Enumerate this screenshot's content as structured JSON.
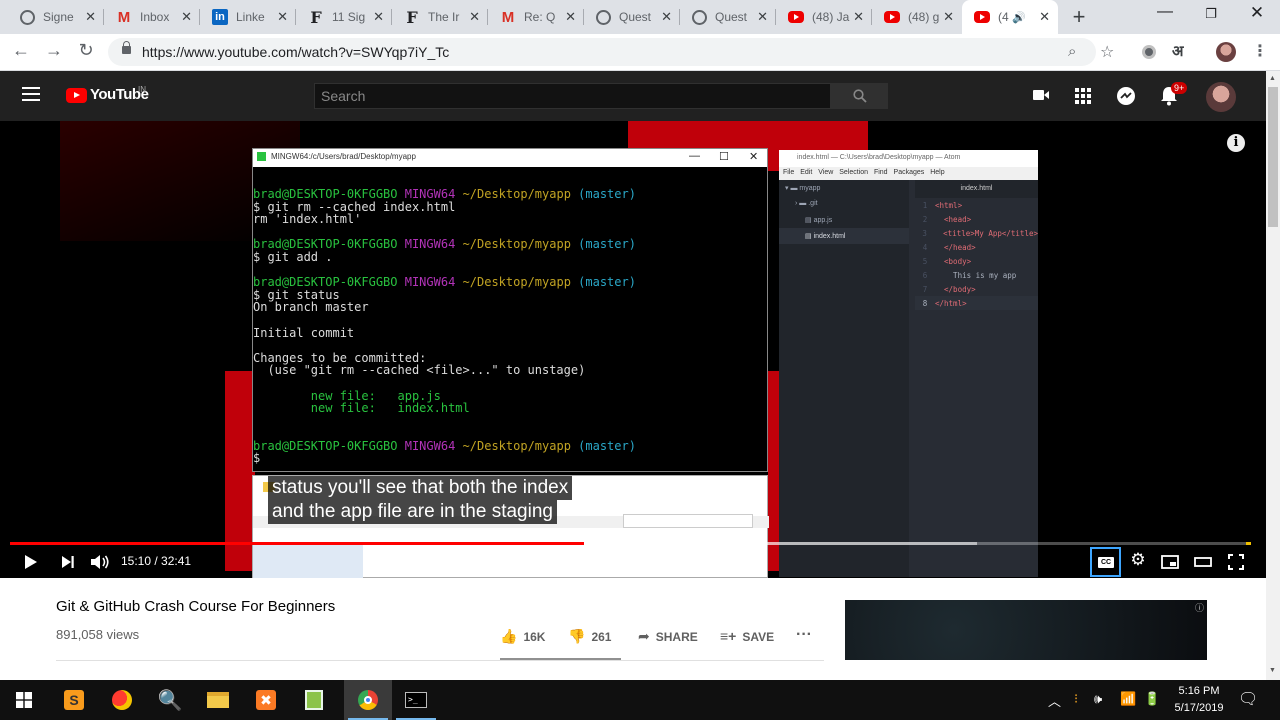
{
  "browser": {
    "tabs": [
      {
        "favicon": "globe-icon",
        "title": "Signe"
      },
      {
        "favicon": "gmail-icon",
        "title": "Inbox"
      },
      {
        "favicon": "linkedin-icon",
        "title": "Linke"
      },
      {
        "favicon": "f-icon",
        "title": "11 Sig"
      },
      {
        "favicon": "f-icon",
        "title": "The Ir"
      },
      {
        "favicon": "gmail-icon",
        "title": "Re: Q"
      },
      {
        "favicon": "globe-icon",
        "title": "Quest"
      },
      {
        "favicon": "globe-icon",
        "title": "Quest"
      },
      {
        "favicon": "youtube-icon",
        "title": "(48) Ja"
      },
      {
        "favicon": "youtube-icon",
        "title": "(48) g"
      },
      {
        "favicon": "youtube-icon",
        "title": "(4",
        "active": true
      }
    ],
    "url": "https://www.youtube.com/watch?v=SWYqp7iY_Tc",
    "lang_glyph": "अ"
  },
  "youtube": {
    "logo_text": "YouTube",
    "region": "IN",
    "search_placeholder": "Search",
    "notifications": "9+"
  },
  "video": {
    "title": "Git & GitHub Crash Course For Beginners",
    "views": "891,058 views",
    "likes": "16K",
    "dislikes": "261",
    "share_label": "SHARE",
    "save_label": "SAVE",
    "current_time": "15:10",
    "duration": "32:41",
    "time_display": "15:10 / 32:41",
    "progress": 0.4627,
    "buffered": 0.78,
    "caption_line1": "status you'll see that both the index",
    "caption_line2": "and the app file are in the staging"
  },
  "terminal": {
    "title": "MINGW64:/c/Users/brad/Desktop/myapp",
    "prompt_user": "brad@DESKTOP-0KFGGBO",
    "prompt_env": "MINGW64",
    "prompt_path": "~/Desktop/myapp",
    "prompt_branch": "(master)",
    "cmd1": "$ git rm --cached index.html",
    "out1": "rm 'index.html'",
    "cmd2": "$ git add .",
    "cmd3": "$ git status",
    "out3a": "On branch master",
    "out3b": "Initial commit",
    "out3c": "Changes to be committed:",
    "out3d": "  (use \"git rm --cached <file>...\" to unstage)",
    "nf1_label": "        new file:   ",
    "nf1_file": "app.js",
    "nf2_label": "        new file:   ",
    "nf2_file": "index.html",
    "cursor": "$"
  },
  "atom": {
    "title": "index.html — C:\\Users\\brad\\Desktop\\myapp — Atom",
    "menu": "File  Edit  View  Selection  Find  Packages  Help",
    "tree": [
      "myapp",
      ".git",
      "app.js",
      "index.html"
    ],
    "tab": "index.html",
    "code": [
      "<html>",
      "  <head>",
      "  <title>My App</title>",
      "  </head>",
      "  <body>",
      "    This is my app",
      "  </body>",
      "</html>"
    ]
  },
  "taskbar": {
    "time": "5:16 PM",
    "date": "5/17/2019"
  }
}
